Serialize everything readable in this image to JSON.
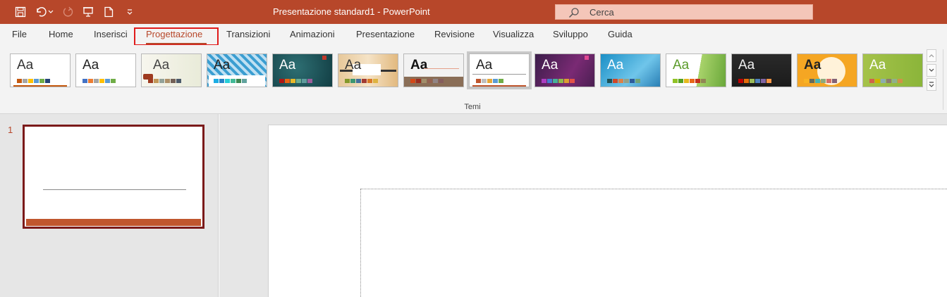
{
  "window": {
    "title": "Presentazione standard1  -  PowerPoint"
  },
  "search": {
    "placeholder": "Cerca"
  },
  "quick_access": [
    "save-icon",
    "undo-icon",
    "undo-dropdown-icon",
    "redo-icon",
    "present-from-start-icon",
    "new-file-icon",
    "customize-qat-icon"
  ],
  "ribbon": {
    "tabs": [
      "File",
      "Home",
      "Inserisci",
      "Progettazione",
      "Transizioni",
      "Animazioni",
      "Presentazione",
      "Revisione",
      "Visualizza",
      "Sviluppo",
      "Guida"
    ],
    "active_tab": "Progettazione",
    "themes_group_label": "Temi",
    "theme_aa_text": "Aa",
    "gallery_scroll": [
      "scroll-up-icon",
      "scroll-down-icon",
      "more-themes-icon"
    ]
  },
  "slides_panel": {
    "slide_number": "1"
  },
  "colors": {
    "accent": "#b7472a",
    "tab_highlight": "#e01b1b",
    "search_bg": "#f4c6b9",
    "pane_bg": "#e6e6e6"
  }
}
